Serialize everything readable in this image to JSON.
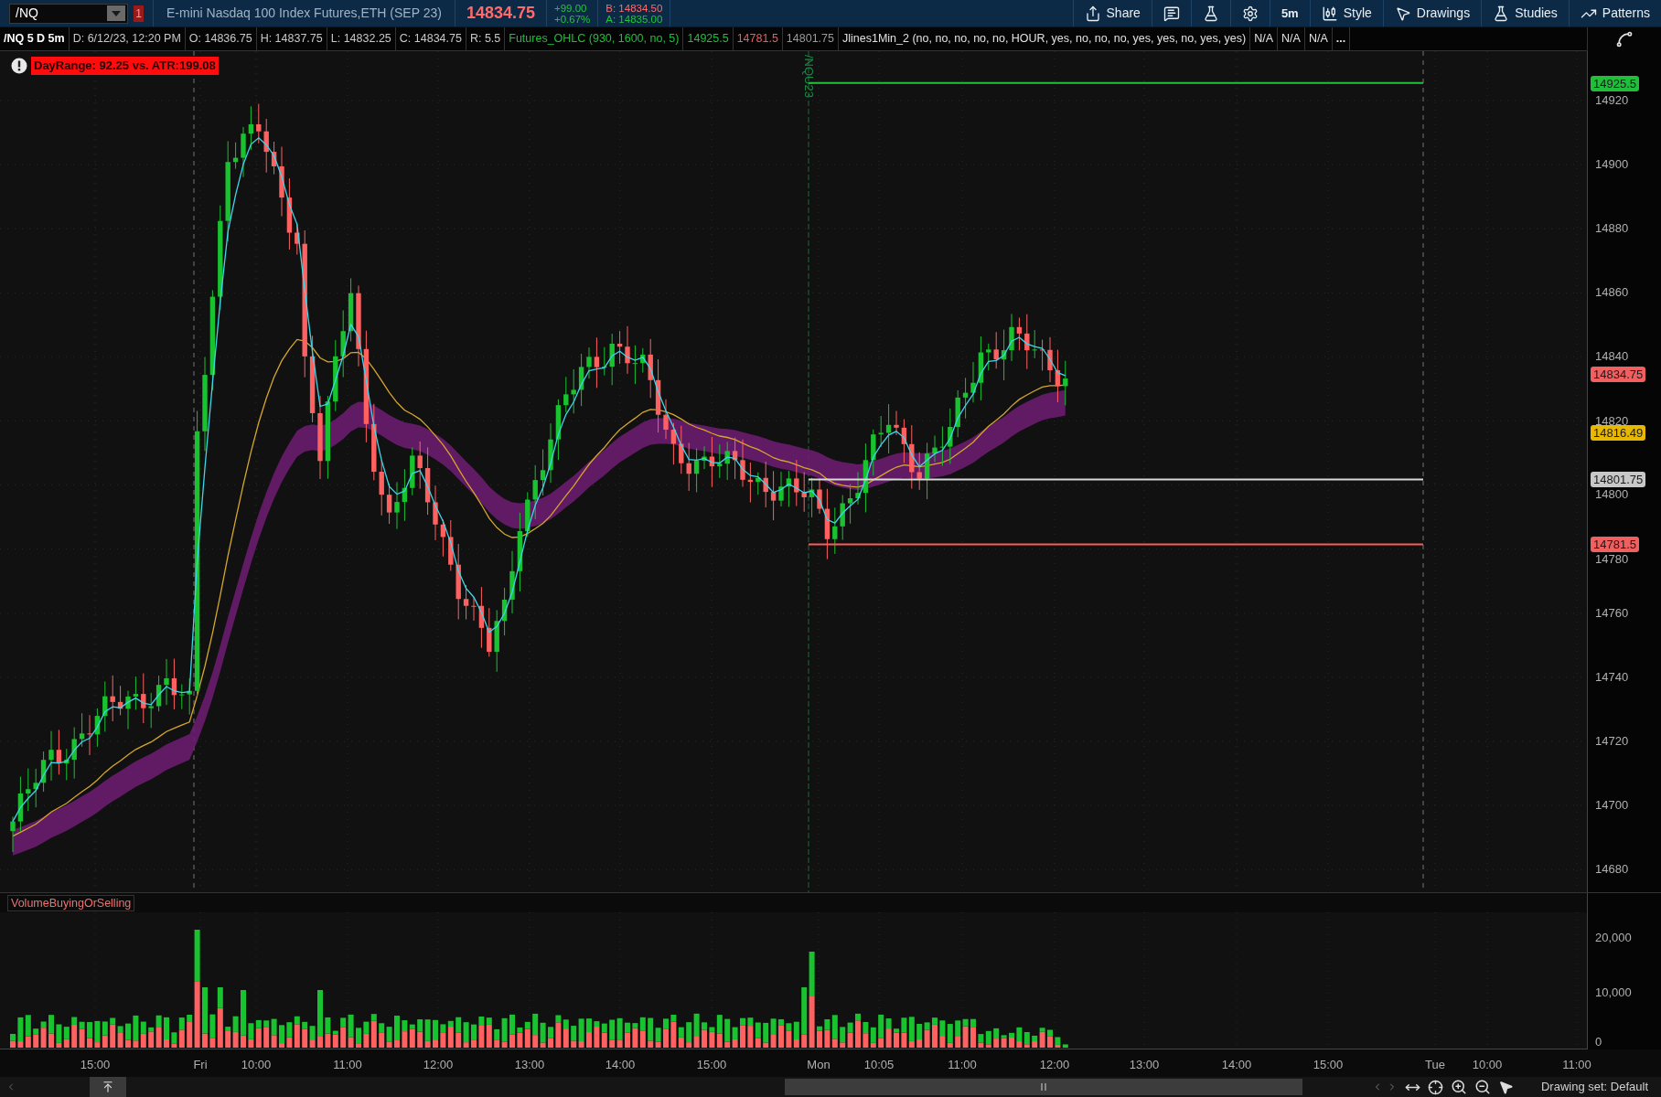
{
  "toolbar": {
    "symbol": "/NQ",
    "alert_badge": "1",
    "description": "E-mini Nasdaq 100 Index Futures,ETH (SEP 23)",
    "last": "14834.75",
    "change": "+99.00",
    "change_pct": "+0.67%",
    "bid": "B: 14834.50",
    "ask": "A: 14835.00",
    "buttons": [
      {
        "kind": "share",
        "label": "Share"
      },
      {
        "kind": "messages"
      },
      {
        "kind": "lab"
      },
      {
        "kind": "settings"
      },
      {
        "kind": "timeframe",
        "label": "5m"
      },
      {
        "kind": "style",
        "label": "Style"
      },
      {
        "kind": "drawings",
        "label": "Drawings"
      },
      {
        "kind": "studies",
        "label": "Studies"
      },
      {
        "kind": "patterns",
        "label": "Patterns"
      }
    ]
  },
  "info_bar": [
    {
      "text": "/NQ 5 D 5m",
      "color": "#ffffff"
    },
    {
      "text": "D: 6/12/23, 12:20 PM",
      "color": "#c8c8c8"
    },
    {
      "text": "O: 14836.75",
      "color": "#c8c8c8"
    },
    {
      "text": "H: 14837.75",
      "color": "#c8c8c8"
    },
    {
      "text": "L: 14832.25",
      "color": "#c8c8c8"
    },
    {
      "text": "C: 14834.75",
      "color": "#c8c8c8"
    },
    {
      "text": "R: 5.5",
      "color": "#c8c8c8"
    },
    {
      "text": "Futures_OHLC (930, 1600, no, 5)",
      "color": "#1fbf3a"
    },
    {
      "text": "14925.5",
      "color": "#1fbf3a"
    },
    {
      "text": "14781.5",
      "color": "#f05a5a"
    },
    {
      "text": "14801.75",
      "color": "#9a9a9a"
    },
    {
      "text": "Jlines1Min_2 (no, no, no, no, no, HOUR, yes, no, no, no, yes, yes, no, yes, yes)",
      "color": "#e0e0e0"
    },
    {
      "text": "N/A",
      "color": "#e0e0e0"
    },
    {
      "text": "N/A",
      "color": "#e0e0e0"
    },
    {
      "text": "N/A",
      "color": "#e0e0e0"
    },
    {
      "text": "...",
      "color": "#e0e0e0"
    }
  ],
  "alert": {
    "text": "DayRange: 92.25 vs. ATR:199.08"
  },
  "price_chart": {
    "contract_label": "/NQU23",
    "y_ticks": [
      "14920",
      "14900",
      "14880",
      "14860",
      "14840",
      "14820",
      "14800",
      "14780",
      "14760",
      "14740",
      "14720",
      "14700",
      "14680"
    ],
    "price_badges": [
      {
        "text": "14925.5",
        "color": "#1fbf3a"
      },
      {
        "text": "14834.75",
        "color": "#f06060"
      },
      {
        "text": "14816.49",
        "color": "#e8b800"
      },
      {
        "text": "14801.75",
        "color": "#c8c8c8"
      },
      {
        "text": "14781.5",
        "color": "#f06060"
      }
    ]
  },
  "volume": {
    "title": "VolumeBuyingOrSelling",
    "y_ticks": [
      "20,000",
      "10,000",
      "0"
    ]
  },
  "x_axis": [
    "15:00",
    "Fri",
    "10:00",
    "11:00",
    "12:00",
    "13:00",
    "14:00",
    "15:00",
    "Mon",
    "10:05",
    "11:00",
    "12:00",
    "13:00",
    "14:00",
    "15:00",
    "Tue",
    "10:00",
    "11:00"
  ],
  "status": {
    "drawing_set": "Drawing set: Default"
  }
}
